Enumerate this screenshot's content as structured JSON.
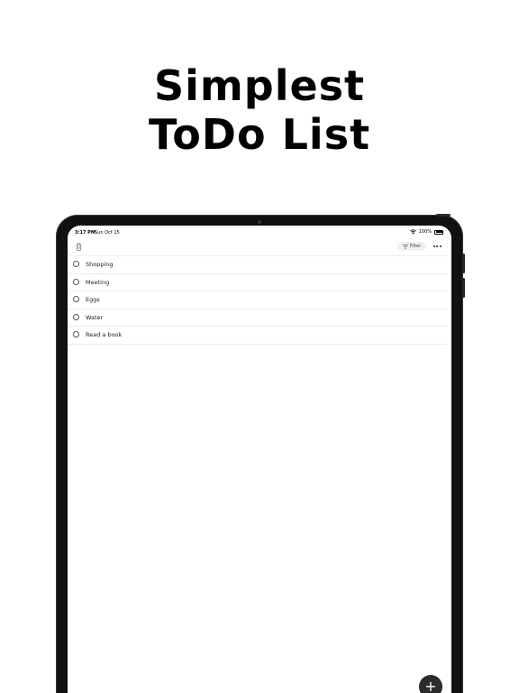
{
  "headline": {
    "line1": "Simplest",
    "line2": "ToDo List"
  },
  "status_bar": {
    "time": "3:17 PM",
    "date": "Sun Oct 15",
    "battery": "100%"
  },
  "toolbar": {
    "filter_label": "Filter"
  },
  "todos": [
    {
      "label": "Shopping",
      "done": false
    },
    {
      "label": "Meeting",
      "done": false
    },
    {
      "label": "Eggs",
      "done": false
    },
    {
      "label": "Water",
      "done": false
    },
    {
      "label": "Read a book",
      "done": false
    }
  ],
  "add_button": {
    "symbol": "+"
  },
  "icons": {
    "trash": "trash-icon",
    "filter": "filter-icon",
    "more": "more-icon",
    "wifi": "wifi-icon",
    "battery": "battery-icon",
    "add": "plus-icon"
  }
}
